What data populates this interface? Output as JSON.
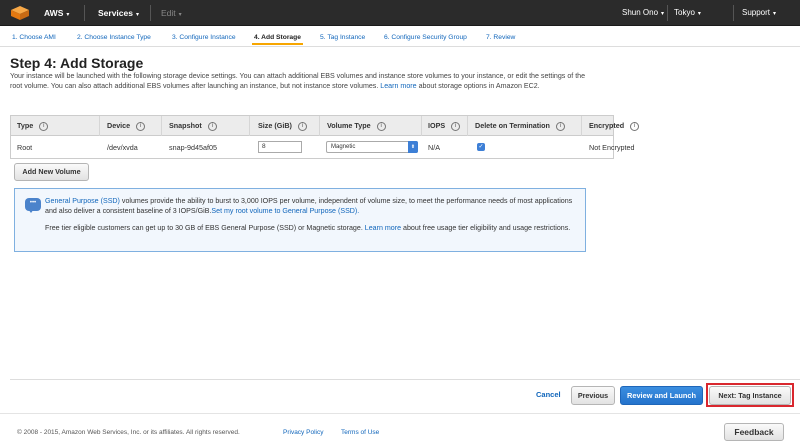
{
  "nav": {
    "brand": "AWS",
    "services": "Services",
    "edit": "Edit",
    "user": "Shun Ono",
    "region": "Tokyo",
    "support": "Support",
    "caret": "▾"
  },
  "steps": [
    {
      "label": "1. Choose AMI"
    },
    {
      "label": "2. Choose Instance Type"
    },
    {
      "label": "3. Configure Instance"
    },
    {
      "label": "4. Add Storage",
      "active": true
    },
    {
      "label": "5. Tag Instance"
    },
    {
      "label": "6. Configure Security Group"
    },
    {
      "label": "7. Review"
    }
  ],
  "page": {
    "title": "Step 4: Add Storage",
    "description_1": "Your instance will be launched with the following storage device settings. You can attach additional EBS volumes and instance store volumes to your instance, or edit the settings of the root volume. You can also attach additional EBS volumes after launching an instance, but not instance store volumes.",
    "learn_more": "Learn more",
    "description_2": "about storage options in Amazon EC2."
  },
  "table": {
    "headers": {
      "type": "Type",
      "device": "Device",
      "snapshot": "Snapshot",
      "size": "Size (GiB)",
      "volume_type": "Volume Type",
      "iops": "IOPS",
      "delete_on_termination": "Delete on Termination",
      "encrypted": "Encrypted"
    },
    "info_glyph": "i",
    "row": {
      "type": "Root",
      "device": "/dev/xvda",
      "snapshot": "snap-9d45af05",
      "size": "8",
      "volume_type": "Magnetic",
      "iops": "N/A",
      "delete_on_termination": true,
      "encrypted": "Not Encrypted"
    }
  },
  "add_volume_label": "Add New Volume",
  "info_box": {
    "p1_link": "General Purpose (SSD)",
    "p1_text": "volumes provide the ability to burst to 3,000 IOPS per volume, independent of volume size, to meet the performance needs of most applications and also deliver a consistent baseline of 3 IOPS/GiB.",
    "p1_link2": "Set my root volume to General Purpose (SSD).",
    "p2_text": "Free tier eligible customers can get up to 30 GB of EBS General Purpose (SSD) or Magnetic storage.",
    "p2_link": "Learn more",
    "p2_text2": "about free usage tier eligibility and usage restrictions."
  },
  "actions": {
    "cancel": "Cancel",
    "previous": "Previous",
    "review": "Review and Launch",
    "next": "Next: Tag Instance"
  },
  "footer": {
    "copyright": "© 2008 - 2015, Amazon Web Services, Inc. or its affiliates. All rights reserved.",
    "privacy": "Privacy Policy",
    "terms": "Terms of Use",
    "feedback": "Feedback"
  },
  "colors": {
    "nav_bg": "#2b2b2b",
    "link": "#1166bb",
    "primary": "#2b7fd8",
    "highlight": "#d9272e",
    "active_tab_underline": "#f7a600"
  }
}
